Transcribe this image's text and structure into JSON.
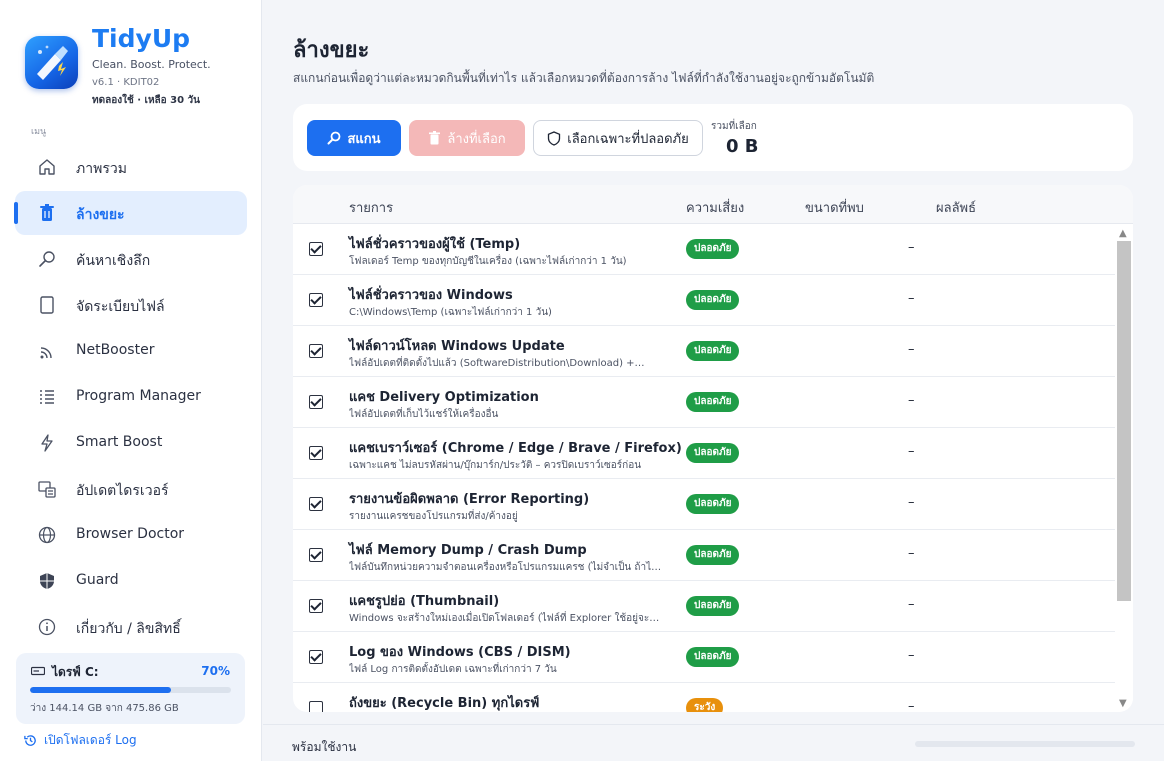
{
  "app": {
    "name": "TidyUp",
    "tagline": "Clean. Boost. Protect.",
    "version": "v6.1  ·  KDIT02",
    "trial": "ทดลองใช้ · เหลือ 30 วัน",
    "menu_label": "เมนู"
  },
  "sidebar": {
    "items": [
      {
        "label": "ภาพรวม",
        "icon": "home-icon",
        "active": false
      },
      {
        "label": "ล้างขยะ",
        "icon": "trash-icon",
        "active": true
      },
      {
        "label": "ค้นหาเชิงลึก",
        "icon": "search-icon",
        "active": false
      },
      {
        "label": "จัดระเบียบไฟล์",
        "icon": "file-icon",
        "active": false
      },
      {
        "label": "NetBooster",
        "icon": "wifi-signal-icon",
        "active": false
      },
      {
        "label": "Program Manager",
        "icon": "list-icon",
        "active": false
      },
      {
        "label": "Smart Boost",
        "icon": "lightning-icon",
        "active": false
      },
      {
        "label": "อัปเดตไดรเวอร์",
        "icon": "driver-icon",
        "active": false
      },
      {
        "label": "Browser Doctor",
        "icon": "globe-icon",
        "active": false
      },
      {
        "label": "Guard",
        "icon": "shield-icon",
        "active": false
      },
      {
        "label": "เกี่ยวกับ / ลิขสิทธิ์",
        "icon": "info-icon",
        "active": false
      }
    ],
    "drive": {
      "label": "ไดรฟ์ C:",
      "percent_text": "70%",
      "used_fraction": 0.7,
      "free_text": "ว่าง 144.14 GB จาก 475.86 GB"
    },
    "log_link": "เปิดโฟลเดอร์ Log"
  },
  "main": {
    "title": "ล้างขยะ",
    "subtitle": "สแกนก่อนเพื่อดูว่าแต่ละหมวดกินพื้นที่เท่าไร แล้วเลือกหมวดที่ต้องการล้าง ไฟล์ที่กำลังใช้งานอยู่จะถูกข้ามอัตโนมัติ",
    "toolbar": {
      "scan": "สแกน",
      "clean_selected": "ล้างที่เลือก",
      "select_safe": "เลือกเฉพาะที่ปลอดภัย",
      "total_label": "รวมที่เลือก",
      "total_value": "0 B"
    },
    "table": {
      "headers": {
        "item": "รายการ",
        "risk": "ความเสี่ยง",
        "size": "ขนาดที่พบ",
        "result": "ผลลัพธ์"
      },
      "rows": [
        {
          "checked": true,
          "title": "ไฟล์ชั่วคราวของผู้ใช้ (Temp)",
          "desc": "โฟลเดอร์ Temp ของทุกบัญชีในเครื่อง (เฉพาะไฟล์เก่ากว่า 1 วัน)",
          "risk": "ปลอดภัย",
          "risk_level": "safe",
          "size": "–"
        },
        {
          "checked": true,
          "title": "ไฟล์ชั่วคราวของ Windows",
          "desc": "C:\\Windows\\Temp (เฉพาะไฟล์เก่ากว่า 1 วัน)",
          "risk": "ปลอดภัย",
          "risk_level": "safe",
          "size": "–"
        },
        {
          "checked": true,
          "title": "ไฟล์ดาวน์โหลด Windows Update",
          "desc": "ไฟล์อัปเดตที่ติดตั้งไปแล้ว (SoftwareDistribution\\Download) +…",
          "risk": "ปลอดภัย",
          "risk_level": "safe",
          "size": "–"
        },
        {
          "checked": true,
          "title": "แคช Delivery Optimization",
          "desc": "ไฟล์อัปเดตที่เก็บไว้แชร์ให้เครื่องอื่น",
          "risk": "ปลอดภัย",
          "risk_level": "safe",
          "size": "–"
        },
        {
          "checked": true,
          "title": "แคชเบราว์เซอร์ (Chrome / Edge / Brave / Firefox)",
          "desc": "เฉพาะแคช ไม่ลบรหัสผ่าน/บุ๊กมาร์ก/ประวัติ – ควรปิดเบราว์เซอร์ก่อน",
          "risk": "ปลอดภัย",
          "risk_level": "safe",
          "size": "–"
        },
        {
          "checked": true,
          "title": "รายงานข้อผิดพลาด (Error Reporting)",
          "desc": "รายงานแครชของโปรแกรมที่ส่ง/ค้างอยู่",
          "risk": "ปลอดภัย",
          "risk_level": "safe",
          "size": "–"
        },
        {
          "checked": true,
          "title": "ไฟล์ Memory Dump / Crash Dump",
          "desc": "ไฟล์บันทึกหน่วยความจำตอนเครื่องหรือโปรแกรมแครช (ไม่จำเป็น ถ้าไ…",
          "risk": "ปลอดภัย",
          "risk_level": "safe",
          "size": "–"
        },
        {
          "checked": true,
          "title": "แคชรูปย่อ (Thumbnail)",
          "desc": "Windows จะสร้างใหม่เองเมื่อเปิดโฟลเดอร์ (ไฟล์ที่ Explorer ใช้อยู่จะ…",
          "risk": "ปลอดภัย",
          "risk_level": "safe",
          "size": "–"
        },
        {
          "checked": true,
          "title": "Log ของ Windows (CBS / DISM)",
          "desc": "ไฟล์ Log การติดตั้งอัปเดต เฉพาะที่เก่ากว่า 7 วัน",
          "risk": "ปลอดภัย",
          "risk_level": "safe",
          "size": "–"
        },
        {
          "checked": false,
          "title": "ถังขยะ (Recycle Bin) ทุกไดรฟ์",
          "desc": "",
          "risk": "ระวัง",
          "risk_level": "warn",
          "size": "–"
        }
      ]
    }
  },
  "status": {
    "text": "พร้อมใช้งาน"
  },
  "colors": {
    "accent": "#1d6ff0",
    "safe": "#1f9d47",
    "warn": "#e8900c",
    "danger_disabled": "#f4b8b8"
  }
}
